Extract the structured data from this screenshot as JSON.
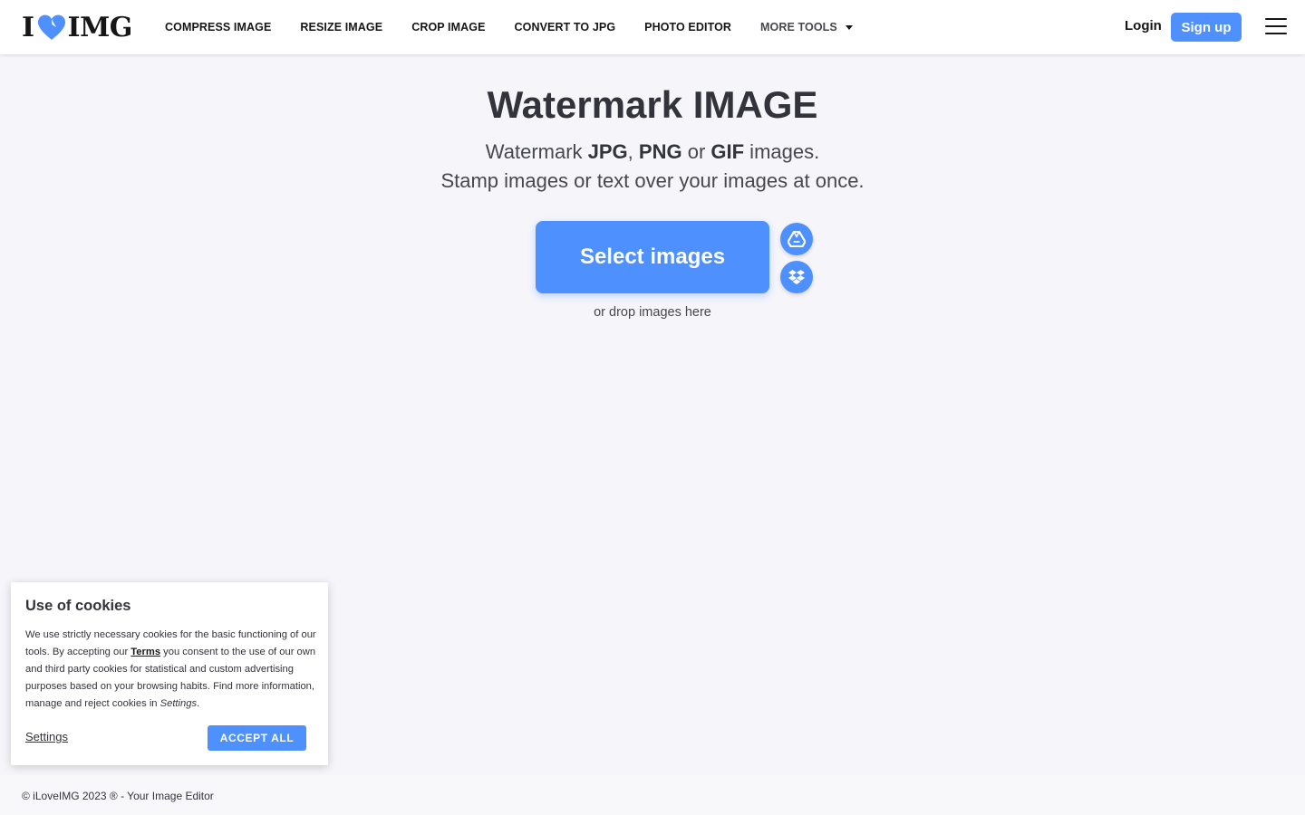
{
  "header": {
    "logo": {
      "left": "I",
      "right": "IMG",
      "heart_color": "#4d90fe"
    },
    "nav": [
      {
        "label": "COMPRESS IMAGE"
      },
      {
        "label": "RESIZE IMAGE"
      },
      {
        "label": "CROP IMAGE"
      },
      {
        "label": "CONVERT TO JPG"
      },
      {
        "label": "PHOTO EDITOR"
      }
    ],
    "more_tools": "MORE TOOLS",
    "login": "Login",
    "signup": "Sign up"
  },
  "main": {
    "title": "Watermark IMAGE",
    "subtitle_line1": {
      "prefix": "Watermark ",
      "fmt1": "JPG",
      "sep1": ", ",
      "fmt2": "PNG",
      "sep2": " or ",
      "fmt3": "GIF",
      "suffix": " images."
    },
    "subtitle_line2": "Stamp images or text over your images at once.",
    "select_button": "Select images",
    "drop_hint": "or drop images here",
    "icons": [
      "google-drive-icon",
      "dropbox-icon"
    ]
  },
  "cookie": {
    "title": "Use of cookies",
    "text_before": "We use strictly necessary cookies for the basic functioning of our tools. By accepting our ",
    "terms_link": "Terms",
    "text_after": " you consent to the use of our own and third party cookies for statistical and custom advertising purposes based on your browsing habits. Find more information, manage and reject cookies in ",
    "settings_italic": "Settings",
    "text_end": ".",
    "settings_link": "Settings",
    "accept_button": "ACCEPT ALL"
  },
  "footer": {
    "text": "© iLoveIMG 2023 ® - Your Image Editor"
  },
  "colors": {
    "accent": "#4d90fe",
    "background": "#f5f5fa",
    "text": "#33333b"
  }
}
